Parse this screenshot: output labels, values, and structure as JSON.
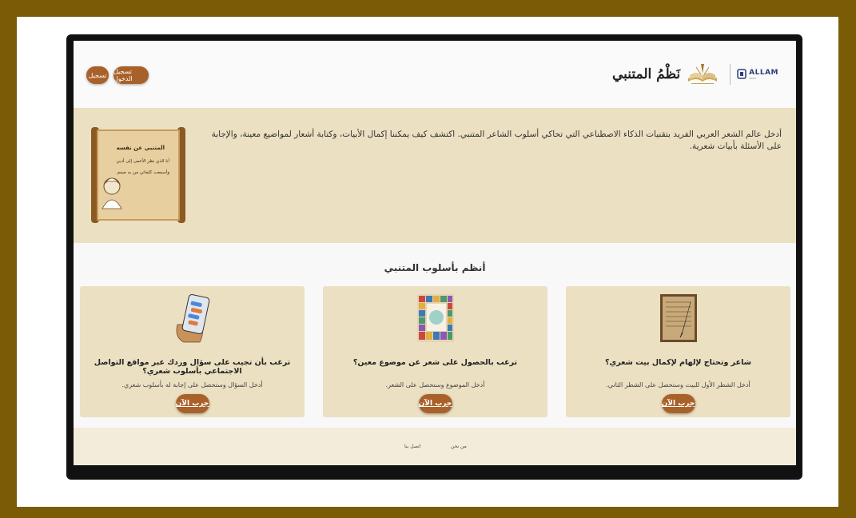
{
  "header": {
    "register_label": "تسجيل",
    "login_label": "تسجيل الدخول",
    "brand_title": "نَظْمُ المتنبي",
    "partner_logo_text": "ALLAM",
    "partner_logo_sub": "SDAIA"
  },
  "hero": {
    "text": "أدخل عالم الشعر العربي الفريد بتقنيات الذكاء الاصطناعي التي تحاكي أسلوب الشاعر المتنبي. اكتشف كيف يمكننا إكمال الأبيات، وكتابة أشعار لمواضيع معينة، والإجابة على الأسئلة بأبيات شعرية.",
    "scroll_heading": "المتنبي عن نفسه",
    "scroll_line1": "أنا الذي نظر الأعمى إلى أدبي",
    "scroll_line2": "وأسمعت كلماتي من به صمم"
  },
  "section": {
    "title": "أنظم بأسلوب المتنبي"
  },
  "cards": [
    {
      "title": "شاعر وتحتاج لإلهام لإكمال بيت شعري؟",
      "desc": "أدخل الشطر الأول للبيت وستحصل على الشطر الثاني.",
      "button": "جرب الآن",
      "icon": "manuscript-quill-icon"
    },
    {
      "title": "ترغب بالحصول على شعر عن موضوع معين؟",
      "desc": "أدخل الموضوع وستحصل على الشعر.",
      "button": "جرب الآن",
      "icon": "mosaic-book-icon"
    },
    {
      "title": "ترغب بأن تجيب على سؤال وردك عبر مواقع التواصل الاجتماعي بأسلوب شعري؟",
      "desc": "أدخل السؤال وستحصل على إجابة له بأسلوب شعري.",
      "button": "جرب الآن",
      "icon": "phone-chat-icon"
    }
  ],
  "footer": {
    "about": "من نحن",
    "contact": "اتصل بنا"
  },
  "colors": {
    "frame": "#7a5c06",
    "accent_button": "#a9612a",
    "hero_bg": "#ece0c3",
    "footer_bg": "#f3ecda"
  }
}
